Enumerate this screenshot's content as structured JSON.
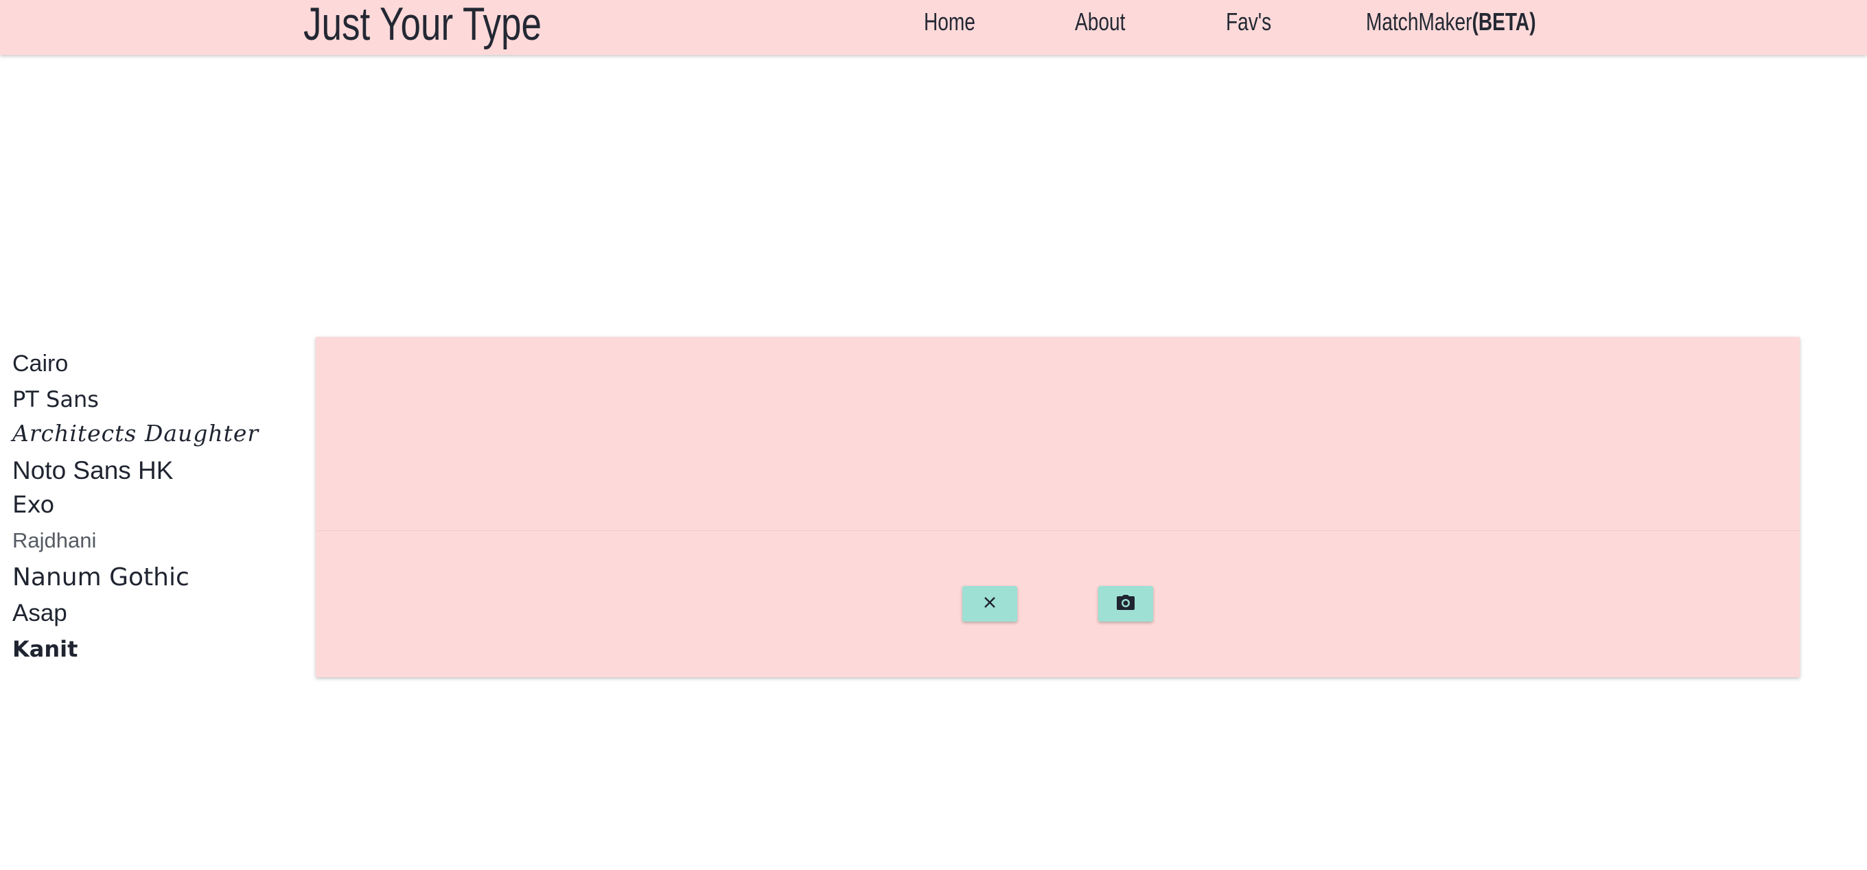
{
  "header": {
    "brand": "Just Your Type",
    "nav": {
      "home": "Home",
      "about": "About",
      "favs": "Fav's",
      "matchmaker": "MatchMaker",
      "matchmaker_beta": "(BETA)"
    },
    "background_color": "#fdd9d9"
  },
  "font_list": [
    "Cairo",
    "PT Sans",
    "Architects Daughter",
    "Noto Sans HK",
    "Exo",
    "Rajdhani",
    "Nanum Gothic",
    "Asap",
    "Kanit"
  ],
  "card": {
    "background_color": "#fdd9d9",
    "actions": {
      "dismiss_icon": "close-icon",
      "capture_icon": "camera-icon",
      "button_color": "#9fe0d4"
    }
  }
}
